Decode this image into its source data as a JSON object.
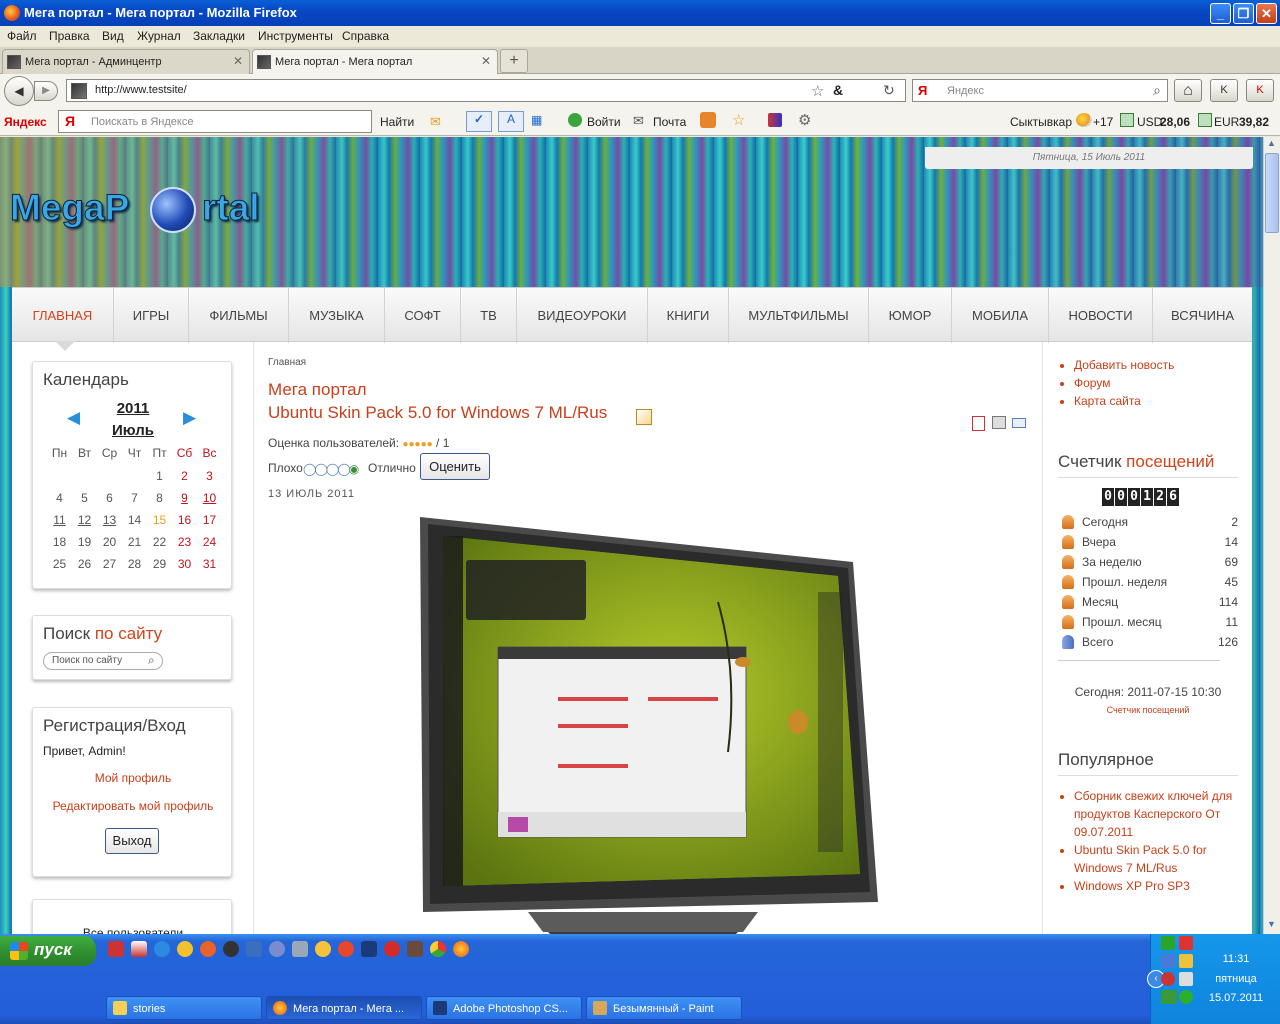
{
  "window": {
    "title": "Мега портал - Мега портал - Mozilla Firefox",
    "minimize": "_",
    "maximize": "❐",
    "close": "✕"
  },
  "menu": [
    "Файл",
    "Правка",
    "Вид",
    "Журнал",
    "Закладки",
    "Инструменты",
    "Справка"
  ],
  "tabs": [
    {
      "label": "Мега портал - Админцентр",
      "close": "✕"
    },
    {
      "label": "Мега портал - Мега портал",
      "close": "✕"
    }
  ],
  "newtab": "+",
  "nav": {
    "back": "◀",
    "forward": "▶",
    "url": "http://www.testsite/",
    "search_placeholder": "Яндекс",
    "home": "⌂"
  },
  "yandexbar": {
    "brand": "Яндекс",
    "ya": "Я",
    "placeholder": "Поискать в Яндексе",
    "find": "Найти",
    "login": "Войти",
    "mail": "Почта",
    "city": "Сыктывкар",
    "temp": "+17",
    "usd_label": "USD",
    "usd": "28,06",
    "eur_label": "EUR",
    "eur": "39,82"
  },
  "site": {
    "date": "Пятница, 15 Июль 2011",
    "logo_left": "MegaP",
    "logo_right": "rtal",
    "topnav": [
      "ГЛАВНАЯ",
      "ИГРЫ",
      "ФИЛЬМЫ",
      "МУЗЫКА",
      "СОФТ",
      "ТВ",
      "ВИДЕОУРОКИ",
      "КНИГИ",
      "МУЛЬТФИЛЬМЫ",
      "ЮМОР",
      "МОБИЛА",
      "НОВОСТИ",
      "ВСЯЧИНА"
    ]
  },
  "calendar": {
    "title": "Календарь",
    "year": "2011",
    "month": "Июль",
    "prev": "◀",
    "next": "▶",
    "weekdays": [
      "Пн",
      "Вт",
      "Ср",
      "Чт",
      "Пт",
      "Сб",
      "Вс"
    ],
    "weeks": [
      [
        "",
        "",
        "",
        "",
        "1",
        "2",
        "3"
      ],
      [
        "4",
        "5",
        "6",
        "7",
        "8",
        "9",
        "10"
      ],
      [
        "11",
        "12",
        "13",
        "14",
        "15",
        "16",
        "17"
      ],
      [
        "18",
        "19",
        "20",
        "21",
        "22",
        "23",
        "24"
      ],
      [
        "25",
        "26",
        "27",
        "28",
        "29",
        "30",
        "31"
      ]
    ]
  },
  "search_box": {
    "title_plain": "Поиск",
    "title_accent": "по сайту",
    "placeholder": "Поиск по сайту"
  },
  "auth_box": {
    "title": "Регистрация/Вход",
    "greeting": "Привет, Admin!",
    "profile": "Мой профиль",
    "edit_profile": "Редактировать мой профиль",
    "logout": "Выход"
  },
  "users_box": {
    "partial": "Все пользователи"
  },
  "article": {
    "breadcrumb": "Главная",
    "category": "Мега портал",
    "title": "Ubuntu Skin Pack 5.0 for Windows 7 ML/Rus",
    "rating_label": "Оценка пользователей:",
    "rating_count": "/ 1",
    "rating_value": 5,
    "bad": "Плохо",
    "good": "Отлично",
    "rate_button": "Оценить",
    "date": "13 ИЮЛЬ 2011"
  },
  "right": {
    "links": [
      "Добавить новость",
      "Форум",
      "Карта сайта"
    ],
    "counter_title_plain": "Счетчик",
    "counter_title_accent": "посещений",
    "counter_digits": [
      "0",
      "0",
      "0",
      "1",
      "2",
      "6"
    ],
    "stats": [
      {
        "label": "Сегодня",
        "value": "2"
      },
      {
        "label": "Вчера",
        "value": "14"
      },
      {
        "label": "За неделю",
        "value": "69"
      },
      {
        "label": "Прошл. неделя",
        "value": "45"
      },
      {
        "label": "Месяц",
        "value": "114"
      },
      {
        "label": "Прошл. месяц",
        "value": "11"
      },
      {
        "label": "Всего",
        "value": "126"
      }
    ],
    "today_line": "Сегодня: 2011-07-15 10:30",
    "counter_link": "Счетчик посещений",
    "popular_title": "Популярное",
    "popular": [
      "Сборник свежих ключей для продуктов Касперского От 09.07.2011",
      "Ubuntu Skin Pack 5.0 for Windows 7 ML/Rus",
      "Windows XP Pro SP3"
    ]
  },
  "taskbar": {
    "start": "пуск",
    "tasks": [
      "stories",
      "Мега портал - Мега ...",
      "Adobe Photoshop CS...",
      "Безымянный - Paint"
    ],
    "time": "11:31",
    "day": "пятница",
    "date": "15.07.2011"
  },
  "colors": {
    "accent": "#d2441c",
    "xp_blue": "#245edb",
    "start_green": "#2e8d2e"
  }
}
